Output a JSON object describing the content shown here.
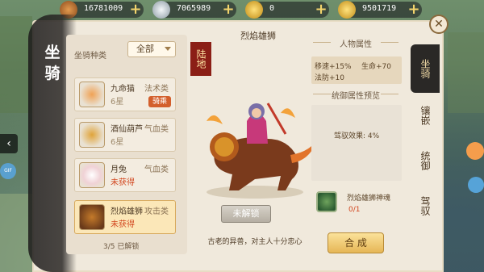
{
  "currencies": [
    {
      "value": "16781009",
      "icon": "coin-icon",
      "color": "#c8742c"
    },
    {
      "value": "7065989",
      "icon": "silver-icon",
      "color": "#c9d2d8"
    },
    {
      "value": "0",
      "icon": "gold-ingot-icon",
      "color": "#f0c33a"
    },
    {
      "value": "9501719",
      "icon": "gold-ingot-icon",
      "color": "#f5c940"
    }
  ],
  "panel": {
    "title": "坐骑"
  },
  "filter": {
    "label": "坐骑种类",
    "selected": "全部"
  },
  "mount_list": [
    {
      "name": "九命猫",
      "type": "法术类",
      "status": "6星",
      "badge": "骑乘",
      "selected": false
    },
    {
      "name": "酒仙葫芦",
      "type": "气血类",
      "status": "6星",
      "badge": "",
      "selected": false
    },
    {
      "name": "月兔",
      "type": "气血类",
      "status": "未获得",
      "badge": "",
      "selected": false
    },
    {
      "name": "烈焰雄狮",
      "type": "攻击类",
      "status": "未获得",
      "badge": "",
      "selected": true
    }
  ],
  "unlocked_count": "3/5 已解锁",
  "selected_mount": {
    "name": "烈焰雄狮",
    "terrain": "陆地",
    "description": "古老的异兽，对主人十分忠心",
    "unlock_label": "未解锁"
  },
  "attributes": {
    "title": "人物属性",
    "items": [
      "移速+15%",
      "生命+70",
      "法防+10"
    ]
  },
  "control": {
    "title": "统御属性预览",
    "effect": "驾驭效果: 4%"
  },
  "soul": {
    "name": "烈焰雄狮神魂",
    "count": "0/1"
  },
  "combine_label": "合 成",
  "tabs": [
    {
      "label": "坐骑",
      "active": true
    },
    {
      "label": "镶嵌",
      "active": false
    },
    {
      "label": "统御",
      "active": false
    },
    {
      "label": "驾驭",
      "active": false
    }
  ],
  "close_label": "✕",
  "left_nav_label": "‹",
  "gif_label": "GIF"
}
